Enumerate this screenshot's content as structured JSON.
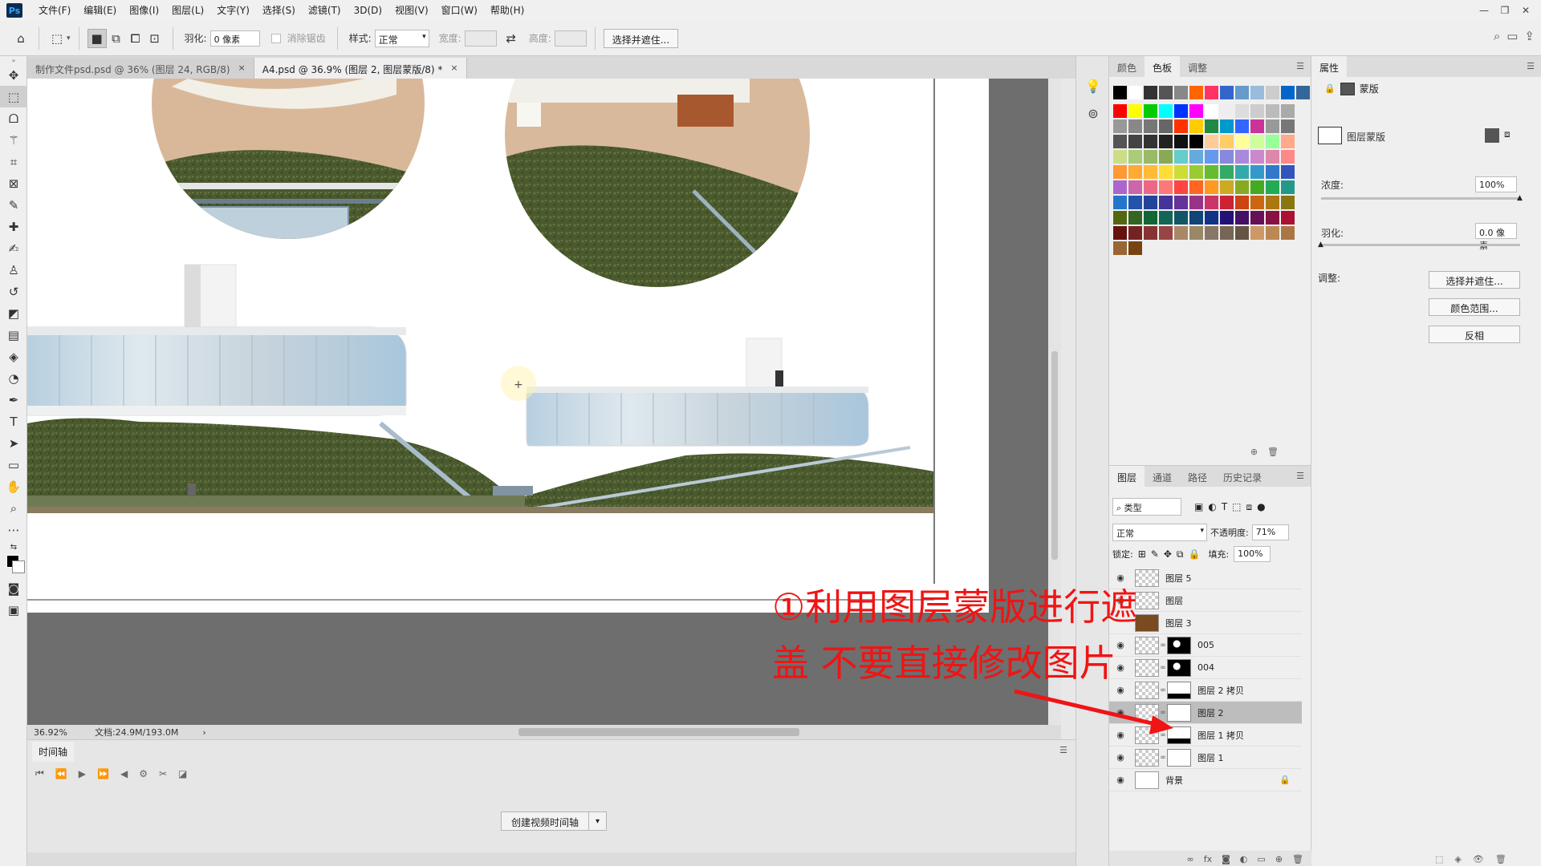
{
  "menu": {
    "logo": "Ps",
    "items": [
      "文件(F)",
      "编辑(E)",
      "图像(I)",
      "图层(L)",
      "文字(Y)",
      "选择(S)",
      "滤镜(T)",
      "3D(D)",
      "视图(V)",
      "窗口(W)",
      "帮助(H)"
    ]
  },
  "options": {
    "feather_label": "羽化:",
    "feather_value": "0 像素",
    "antialias_label": "消除锯齿",
    "style_label": "样式:",
    "style_value": "正常",
    "width_label": "宽度:",
    "height_label": "高度:",
    "select_mask_btn": "选择并遮住..."
  },
  "tabs": [
    {
      "label": "制作文件psd.psd @ 36% (图层 24, RGB/8)",
      "close": "×"
    },
    {
      "label": "A4.psd @ 36.9% (图层 2, 图层蒙版/8) *",
      "close": "×"
    }
  ],
  "status": {
    "zoom": "36.92%",
    "doc_size": "文档:24.9M/193.0M"
  },
  "timeline": {
    "tab_label": "时间轴",
    "create_btn": "创建视频时间轴"
  },
  "swatches": {
    "tabs": [
      "颜色",
      "色板",
      "调整"
    ],
    "colors": [
      [
        "#000000",
        "#ffffff",
        "#333333",
        "#555555",
        "#888888",
        "#ff6600",
        "#ff3366",
        "#3366cc",
        "#6699cc",
        "#99bbdd",
        "#cccccc",
        "#0066cc",
        "#336699",
        "#4499bb"
      ],
      [
        "#ff0000",
        "#ffff00",
        "#00cc00",
        "#00ffff",
        "#0033ff",
        "#ff00ff",
        "#ffffff",
        "#eeeeee",
        "#dddddd",
        "#cccccc",
        "#bbbbbb",
        "#aaaaaa"
      ],
      [
        "#999999",
        "#888888",
        "#777777",
        "#666666",
        "#ff3300",
        "#ffcc00",
        "#228844",
        "#0099cc",
        "#3366ff",
        "#cc3399",
        "#999999",
        "#777777"
      ],
      [
        "#555555",
        "#444444",
        "#333333",
        "#222222",
        "#111111",
        "#000000",
        "#ffcc99",
        "#ffcc66",
        "#ffff99",
        "#ccff99",
        "#99ff99",
        "#ffaa88"
      ],
      [
        "#ccdd88",
        "#aacc77",
        "#99bb66",
        "#88aa55",
        "#66cccc",
        "#66aadd",
        "#6699ee",
        "#8888dd",
        "#aa88dd",
        "#cc88cc",
        "#dd88aa",
        "#ff8888"
      ],
      [
        "#ff9933",
        "#ffaa33",
        "#ffbb33",
        "#ffdd33",
        "#ccdd33",
        "#99cc33",
        "#66bb33",
        "#33aa66",
        "#33aaaa",
        "#3399cc",
        "#3377cc",
        "#3355bb"
      ],
      [
        "#aa66cc",
        "#cc66aa",
        "#ee6688",
        "#ff7777",
        "#ff4444",
        "#ff6622",
        "#ff9922",
        "#ccaa22",
        "#88aa22",
        "#44aa22",
        "#22aa55",
        "#229988"
      ],
      [
        "#2277cc",
        "#2255aa",
        "#224499",
        "#443399",
        "#663399",
        "#993388",
        "#cc3366",
        "#cc2233",
        "#cc4411",
        "#cc6611",
        "#aa7711",
        "#887711"
      ],
      [
        "#556611",
        "#336622",
        "#116633",
        "#116655",
        "#115566",
        "#114477",
        "#113388",
        "#221177",
        "#441166",
        "#661155",
        "#881144",
        "#aa1133"
      ],
      [
        "#661111",
        "#772222",
        "#883333",
        "#994444",
        "#aa8866",
        "#998866",
        "#887766",
        "#776655",
        "#665544",
        "#cc9966",
        "#bb8855",
        "#aa7744"
      ],
      [
        "#996633",
        "#774411"
      ]
    ]
  },
  "layers": {
    "tabs": [
      "图层",
      "通道",
      "路径",
      "历史记录"
    ],
    "filter_label": "类型",
    "blend_mode": "正常",
    "opacity_label": "不透明度:",
    "opacity_value": "71%",
    "lock_label": "锁定:",
    "fill_label": "填充:",
    "fill_value": "100%",
    "items": [
      {
        "name": "图层 5",
        "visible": true,
        "mask": "none",
        "selected": false
      },
      {
        "name": "图层",
        "visible": true,
        "mask": "none",
        "selected": false
      },
      {
        "name": "图层 3",
        "visible": false,
        "mask": "none",
        "selected": false
      },
      {
        "name": "005",
        "visible": true,
        "mask": "black-white-dot",
        "selected": false
      },
      {
        "name": "004",
        "visible": true,
        "mask": "black-white-dot",
        "selected": false
      },
      {
        "name": "图层 2 拷贝",
        "visible": true,
        "mask": "white-bottom-black",
        "selected": false
      },
      {
        "name": "图层 2",
        "visible": true,
        "mask": "white",
        "selected": true
      },
      {
        "name": "图层 1 拷贝",
        "visible": true,
        "mask": "white-bottom-black",
        "selected": false
      },
      {
        "name": "图层 1",
        "visible": true,
        "mask": "white",
        "selected": false
      },
      {
        "name": "背景",
        "visible": true,
        "mask": "none",
        "selected": false,
        "locked": true
      }
    ]
  },
  "properties": {
    "tab": "属性",
    "mask_type": "蒙版",
    "layer_mask_label": "图层蒙版",
    "density_label": "浓度:",
    "density_value": "100%",
    "feather_label": "羽化:",
    "feather_value": "0.0 像素",
    "adjust_label": "调整:",
    "buttons": [
      "选择并遮住...",
      "颜色范围...",
      "反相"
    ]
  },
  "annotation": {
    "line1": "①利用图层蒙版进行遮",
    "line2": "盖  不要直接修改图片",
    "color": "#f01414"
  }
}
